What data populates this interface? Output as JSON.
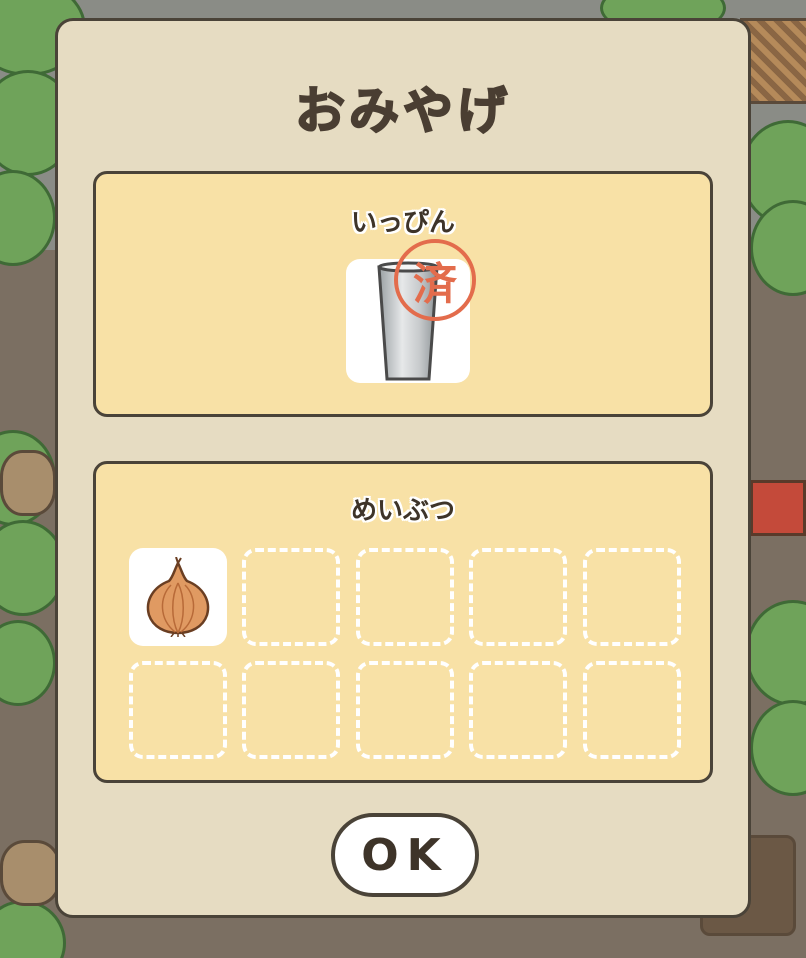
{
  "dialog": {
    "title": "おみやげ",
    "specialty_section": {
      "label": "いっぴん",
      "item": {
        "icon": "tumbler-icon",
        "stamp": "済"
      }
    },
    "local_section": {
      "label": "めいぶつ",
      "slots": [
        {
          "icon": "onion-icon",
          "filled": true
        },
        {
          "filled": false
        },
        {
          "filled": false
        },
        {
          "filled": false
        },
        {
          "filled": false
        },
        {
          "filled": false
        },
        {
          "filled": false
        },
        {
          "filled": false
        },
        {
          "filled": false
        },
        {
          "filled": false
        }
      ]
    },
    "ok_label": "OK"
  },
  "colors": {
    "dialog_bg": "#e6dcc2",
    "panel_bg": "#f8e1a6",
    "border": "#4a4338",
    "stamp": "#e36c4c"
  }
}
